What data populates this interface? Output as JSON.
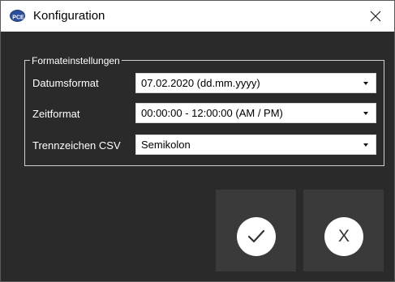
{
  "window": {
    "title": "Konfiguration",
    "icon": "pce-logo-icon",
    "close_glyph": "✕"
  },
  "group": {
    "title": "Formateinstellungen",
    "rows": [
      {
        "label": "Datumsformat",
        "value": "07.02.2020 (dd.mm.yyyy)"
      },
      {
        "label": "Zeitformat",
        "value": "00:00:00 - 12:00:00 (AM / PM)"
      },
      {
        "label": "Trennzeichen CSV",
        "value": "Semikolon"
      }
    ]
  },
  "buttons": {
    "ok_icon": "checkmark-icon",
    "cancel_label": "X"
  },
  "colors": {
    "background": "#2a2a2a",
    "button": "#3a3a3a",
    "accent_icon": "#2b4f9a"
  }
}
